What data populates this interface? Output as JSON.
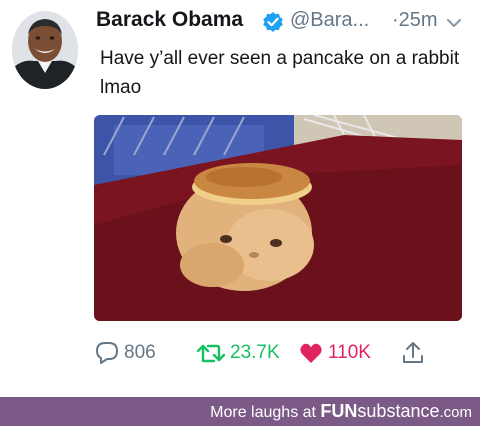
{
  "tweet": {
    "author_name": "Barack Obama",
    "handle": "@Bara...",
    "separator": "·",
    "time": "25m",
    "text": "Have y’all ever seen a pancake on a rabbit lmao",
    "verified": true,
    "verified_color": "#1da1f2"
  },
  "icons": {
    "verified": "verified-badge-icon",
    "caret": "chevron-down-icon",
    "reply": "reply-bubble-icon",
    "retweet": "retweet-icon",
    "like": "heart-icon",
    "share": "share-upload-icon"
  },
  "actions": {
    "replies": "806",
    "retweets": "23.7K",
    "likes": "110K"
  },
  "colors": {
    "retweet": "#17bf63",
    "like": "#e0245e",
    "muted": "#657786",
    "footer_bg": "#7b5a88"
  },
  "footer": {
    "prefix": "More laughs at ",
    "brand": "FUN",
    "brand_rest": "substance",
    "domain": ".com"
  }
}
